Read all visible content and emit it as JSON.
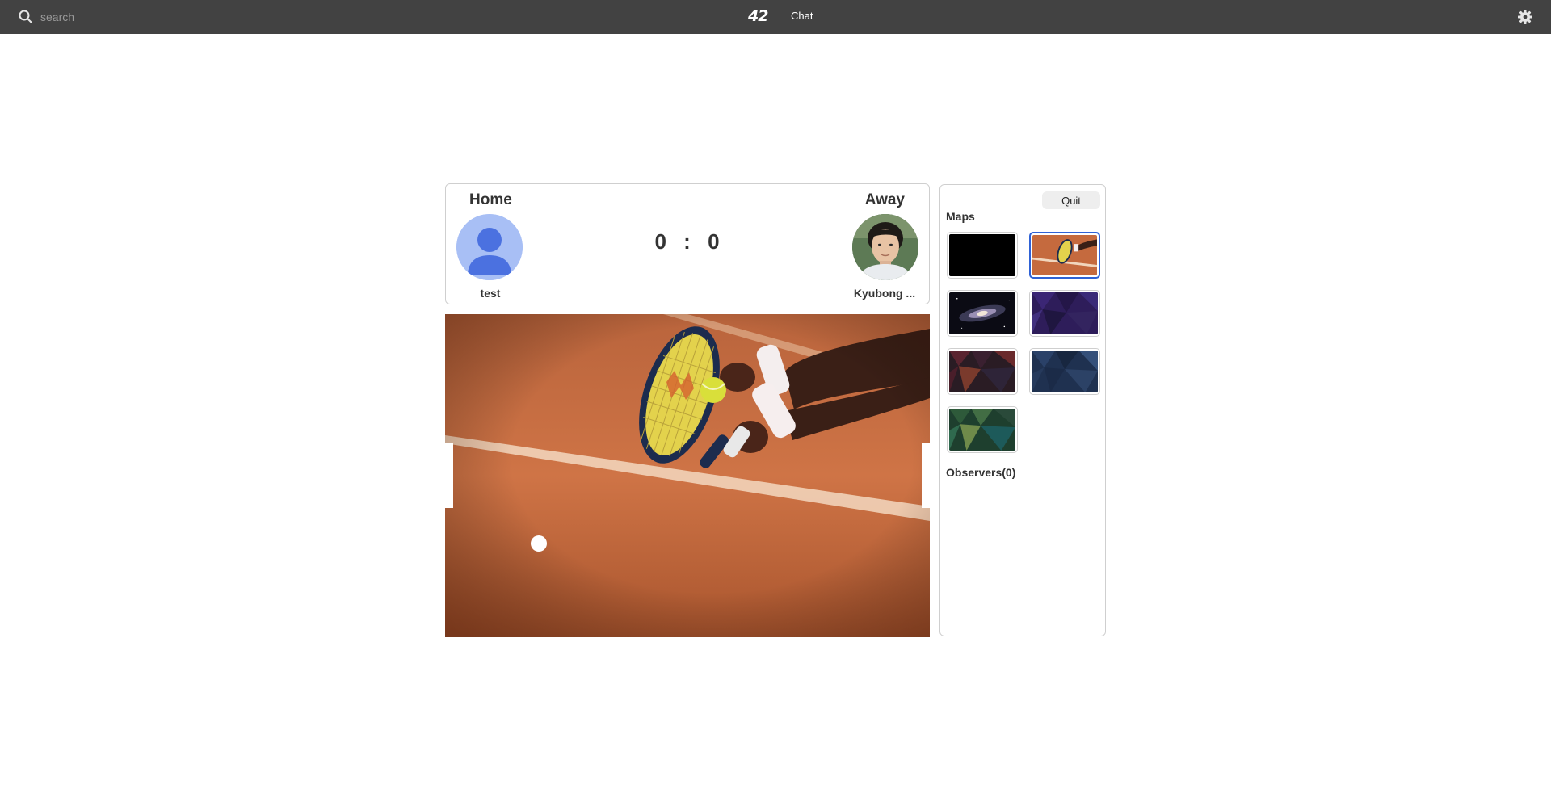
{
  "topbar": {
    "search_placeholder": "search",
    "logo_text": "42",
    "chat_label": "Chat"
  },
  "scoreboard": {
    "home_label": "Home",
    "away_label": "Away",
    "home_player": "test",
    "away_player": "Kyubong ...",
    "home_score": "0",
    "separator": ":",
    "away_score": "0"
  },
  "panel": {
    "quit_label": "Quit",
    "maps_title": "Maps",
    "observers_title": "Observers(0)",
    "selected_map": "tennis-court"
  },
  "colors": {
    "topbar": "#424242",
    "accent": "#2f62d6",
    "court": "#c0663a"
  }
}
